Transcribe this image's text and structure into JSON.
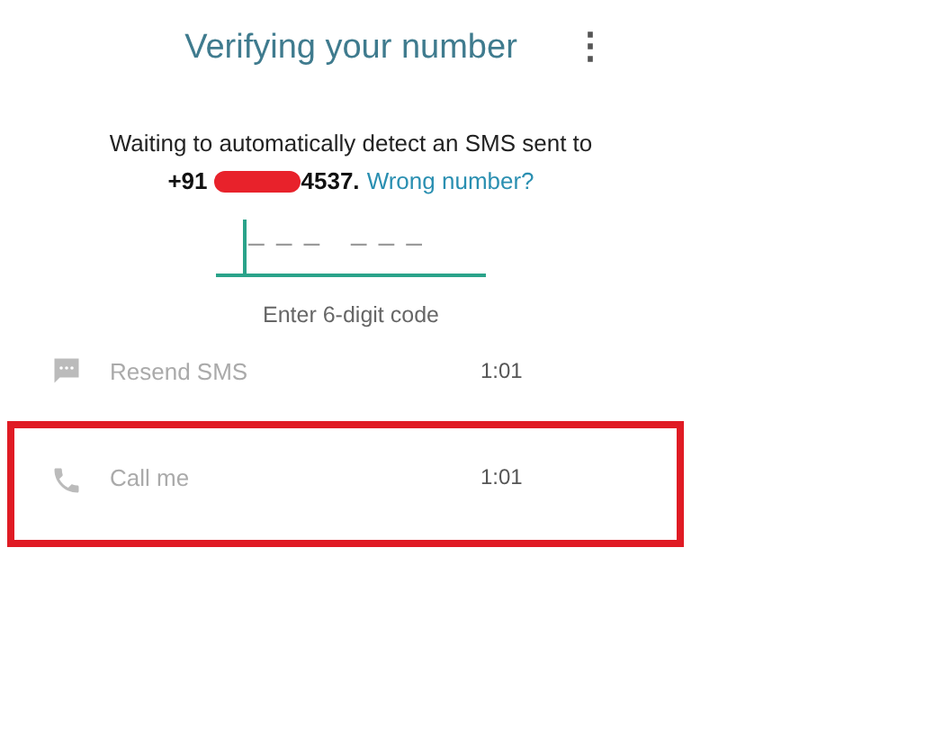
{
  "header": {
    "title": "Verifying your number",
    "menu": "⋮"
  },
  "message": {
    "text": "Waiting to automatically detect an SMS sent to",
    "number_prefix": "+91",
    "number_redacted": true,
    "number_suffix": "4537.",
    "link": "Wrong number?"
  },
  "code_field": {
    "placeholder": "– – –   – – –",
    "focused": true,
    "hint": "Enter 6-digit code"
  },
  "options": [
    {
      "kind": "sms",
      "label": "Resend SMS",
      "timer": "1:01",
      "disabled": true,
      "highlighted": false
    },
    {
      "kind": "call",
      "label": "Call me",
      "timer": "1:01",
      "disabled": true,
      "highlighted": true
    }
  ]
}
